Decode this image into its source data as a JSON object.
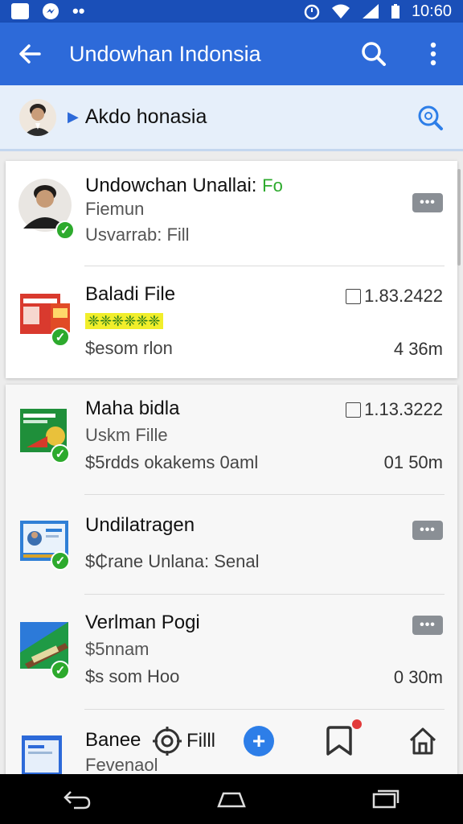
{
  "status_bar": {
    "time": "10:60"
  },
  "app_bar": {
    "title": "Undowhan Indonsia"
  },
  "sub_header": {
    "title": "Akdo honasia"
  },
  "items": [
    {
      "title": "Undowchan Unallai:",
      "tag": "Fo",
      "subtitle": "Fiemun",
      "detail": "Usvarrab: Fill"
    },
    {
      "title": "Baladi File",
      "highlight": "❈❈❈❈❈❈",
      "detail": "$esom rlon",
      "date": "1.83.2422",
      "size": "4 36m"
    },
    {
      "title": "Maha bidla",
      "subtitle": "Uskm Fille",
      "detail": "$5rdds okakems 0aml",
      "date": "1.13.3222",
      "size": "01 50m"
    },
    {
      "title": "Undilatragen",
      "detail": "$₵rane Unlana: Senal"
    },
    {
      "title": "Verlman Pogi",
      "subtitle": "$5nnam",
      "detail": "$s som Hoo",
      "size": "0 30m"
    },
    {
      "title": "Banee",
      "subtitle": "Fevenaol"
    }
  ],
  "bottom_nav": {
    "fill_label": "Filll"
  },
  "colors": {
    "primary": "#2d6ad9",
    "status": "#1a4fb8",
    "check": "#2daa2d",
    "accent_fab": "#2d7ee8"
  }
}
